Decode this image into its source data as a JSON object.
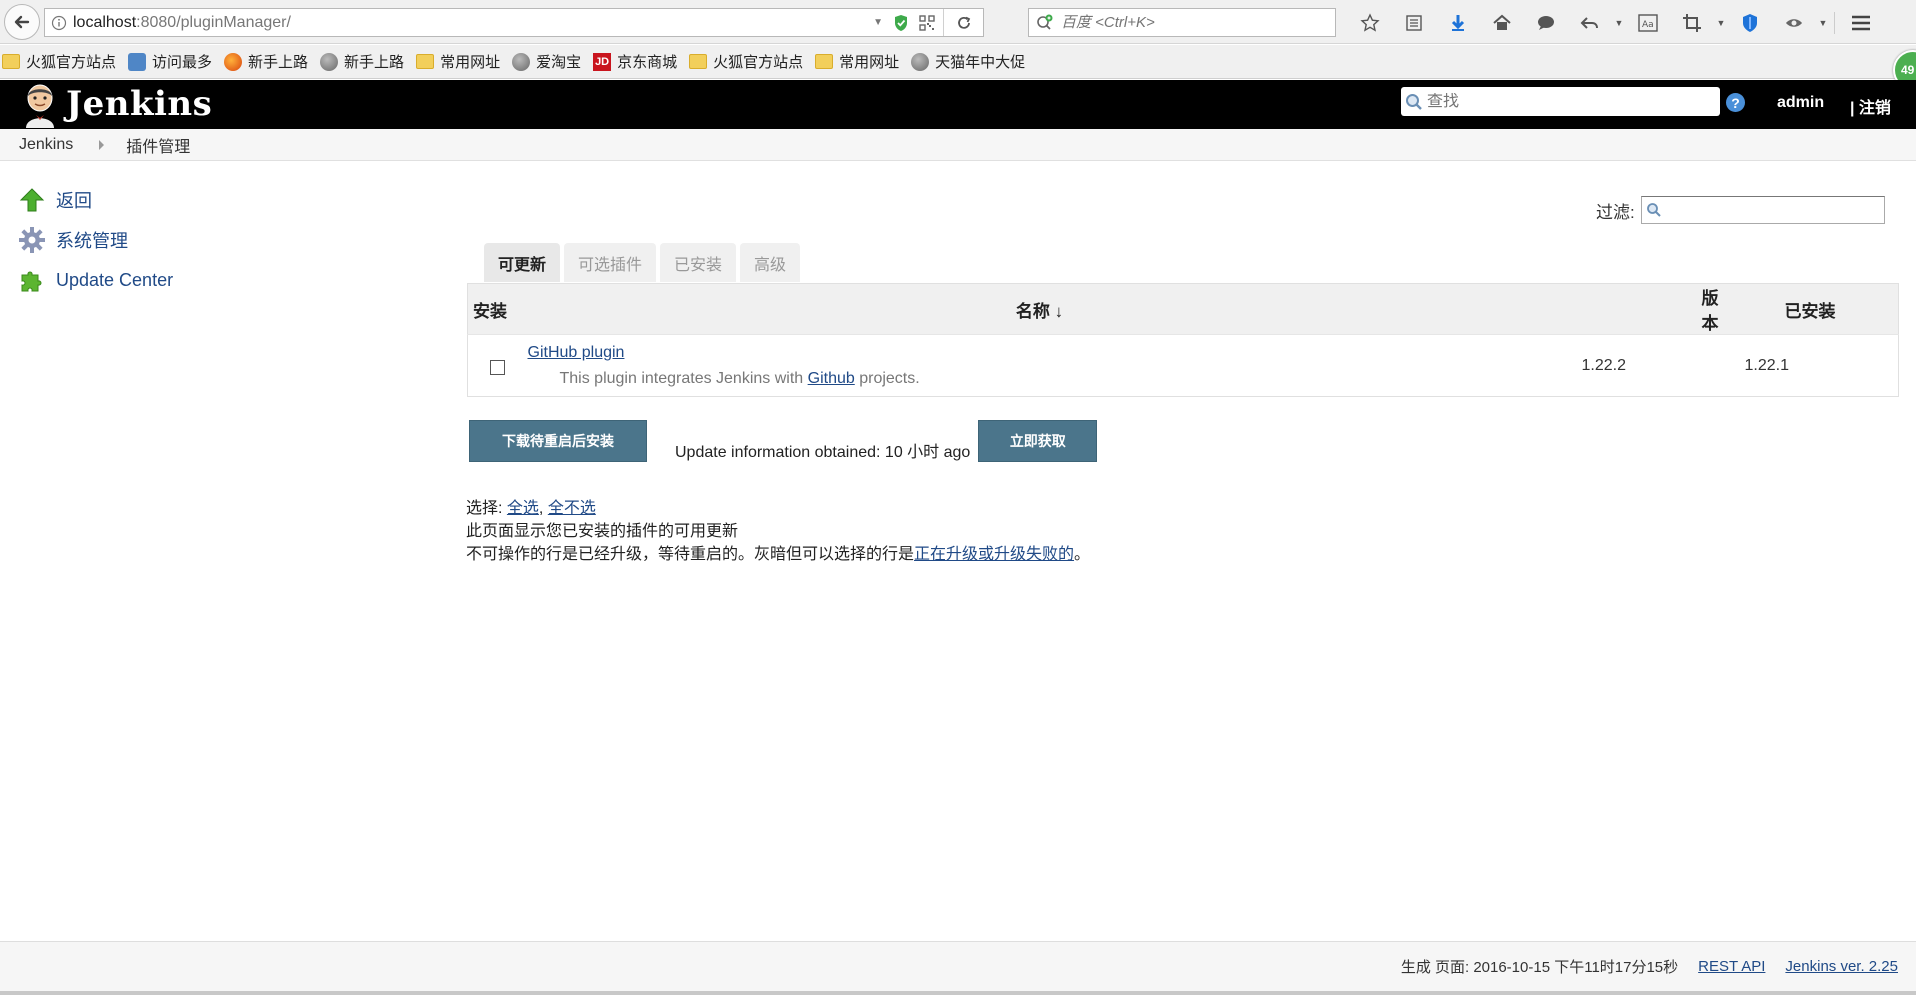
{
  "browser": {
    "url_host": "localhost",
    "url_rest": ":8080/pluginManager/",
    "search_placeholder": "百度 <Ctrl+K>",
    "badge_count": "49"
  },
  "bookmarks": [
    {
      "label": "火狐官方站点",
      "icon": "folder-icon"
    },
    {
      "label": "访问最多",
      "icon": "visit-icon"
    },
    {
      "label": "新手上路",
      "icon": "firefox-icon"
    },
    {
      "label": "新手上路",
      "icon": "globe-icon"
    },
    {
      "label": "常用网址",
      "icon": "folder-icon"
    },
    {
      "label": "爱淘宝",
      "icon": "globe-icon"
    },
    {
      "label": "京东商城",
      "icon": "jd-icon"
    },
    {
      "label": "火狐官方站点",
      "icon": "folder-icon"
    },
    {
      "label": "常用网址",
      "icon": "folder-icon"
    },
    {
      "label": "天猫年中大促",
      "icon": "globe-icon"
    }
  ],
  "header": {
    "title": "Jenkins",
    "search_placeholder": "查找",
    "user": "admin",
    "logout": "| 注销"
  },
  "breadcrumb": {
    "root": "Jenkins",
    "current": "插件管理"
  },
  "sidebar": {
    "items": [
      {
        "label": "返回",
        "icon": "up-arrow-icon"
      },
      {
        "label": "系统管理",
        "icon": "gear-icon"
      },
      {
        "label": "Update Center",
        "icon": "puzzle-icon"
      }
    ]
  },
  "filter": {
    "label": "过滤:"
  },
  "tabs": [
    {
      "label": "可更新",
      "active": true
    },
    {
      "label": "可选插件",
      "active": false
    },
    {
      "label": "已安装",
      "active": false
    },
    {
      "label": "高级",
      "active": false
    }
  ],
  "table": {
    "headers": {
      "install": "安装",
      "name": "名称 ↓",
      "version": "版本",
      "installed": "已安装"
    },
    "rows": [
      {
        "name": "GitHub plugin",
        "desc_before": "This plugin integrates Jenkins with ",
        "desc_link": "Github",
        "desc_after": " projects.",
        "version": "1.22.2",
        "installed": "1.22.1",
        "checked": false
      }
    ]
  },
  "actions": {
    "install_button": "下载待重启后安装",
    "update_info": "Update information obtained: 10 小时 ago",
    "check_now_button": "立即获取"
  },
  "notes": {
    "select_label": "选择: ",
    "select_all": "全选",
    "select_sep": ", ",
    "select_none": "全不选",
    "line2": "此页面显示您已安装的插件的可用更新",
    "line3_before": "不可操作的行是已经升级，等待重启的。灰暗但可以选择的行是",
    "line3_link": "正在升级或升级失败的",
    "line3_after": "。"
  },
  "footer": {
    "generated": "生成 页面: 2016-10-15 下午11时17分15秒",
    "rest_api": "REST API",
    "version": "Jenkins ver. 2.25"
  },
  "colors": {
    "header_bg": "#000000",
    "button_bg": "#4b758b",
    "link": "#204a87"
  }
}
